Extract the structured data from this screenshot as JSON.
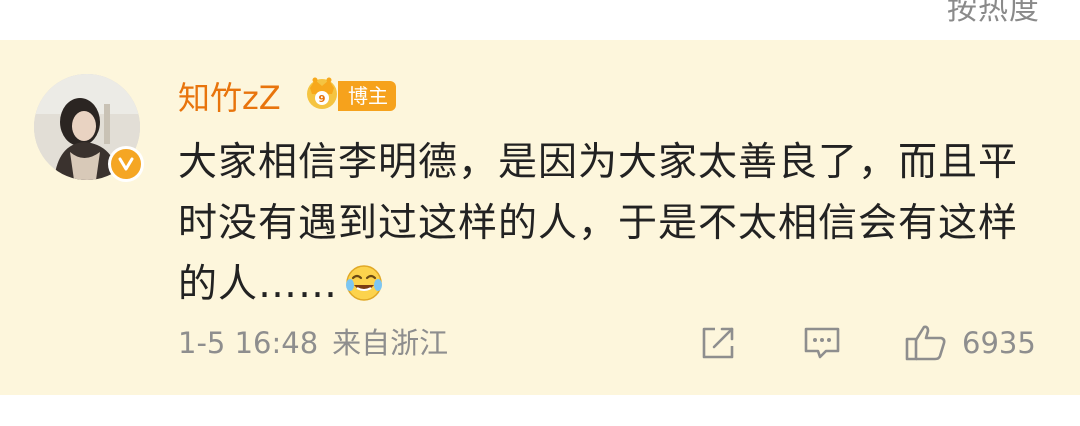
{
  "header": {
    "sort_label": "按热度"
  },
  "comment": {
    "username": "知竹zZ",
    "role_badge": "博主",
    "text": "大家相信李明德，是因为大家太善良了，而且平时没有遇到过这样的人，于是不太相信会有这样的人……",
    "emoji": "laugh-cry-emoji",
    "date": "1-5 16:48",
    "location": "来自浙江",
    "like_count": "6935"
  },
  "colors": {
    "card_background": "#fdf6dc",
    "username": "#e8740c",
    "badge": "#f6a21c",
    "meta_text": "#8e8e8e",
    "body_text": "#222222"
  },
  "icons": [
    "crown-icon",
    "verified-icon",
    "share-icon",
    "comment-icon",
    "like-icon",
    "laugh-cry-emoji"
  ]
}
